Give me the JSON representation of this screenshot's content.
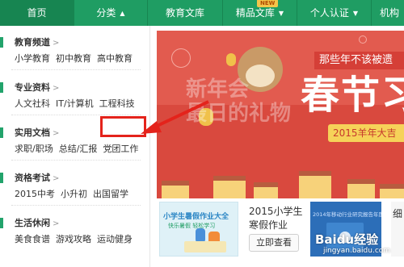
{
  "nav": {
    "items": [
      {
        "label": "首页",
        "caret": ""
      },
      {
        "label": "分类",
        "caret": "▲"
      },
      {
        "label": "教育文库",
        "caret": ""
      },
      {
        "label": "精品文库",
        "caret": "▼"
      },
      {
        "label": "个人认证",
        "caret": "▼"
      },
      {
        "label": "机构",
        "caret": ""
      }
    ],
    "new_badge": "NEW",
    "colors": {
      "bg": "#1f9d63",
      "active": "#178551"
    }
  },
  "menu": {
    "groups": [
      {
        "title": "教育频道",
        "arrow": ">",
        "links": [
          "小学教育",
          "初中教育",
          "高中教育"
        ]
      },
      {
        "title": "专业资料",
        "arrow": ">",
        "links": [
          "人文社科",
          "IT/计算机",
          "工程科技"
        ]
      },
      {
        "title": "实用文档",
        "arrow": ">",
        "links": [
          "求职/职场",
          "总结/汇报",
          "党团工作"
        ]
      },
      {
        "title": "资格考试",
        "arrow": ">",
        "links": [
          "2015中考",
          "小升初",
          "出国留学"
        ]
      },
      {
        "title": "生活休闲",
        "arrow": ">",
        "links": [
          "美食食谱",
          "游戏攻略",
          "运动健身"
        ]
      }
    ]
  },
  "banner": {
    "top_text": "那些年不该被遗",
    "headline": "春节习俗",
    "faded_text": "新年会\n最日的礼物",
    "year_text": "2015羊年大吉"
  },
  "cards": {
    "summer_caption": "小学生暑假作业大全",
    "summer_sub": "快乐暑假 轻松学习",
    "title": "2015小学生寒假作业",
    "button": "立即查看",
    "report_caption": "2014年移动行业研究报告年度盘点",
    "edge_text": "细"
  },
  "watermark": {
    "text": "Baidu经验",
    "url": "jingyan.baidu.com"
  }
}
